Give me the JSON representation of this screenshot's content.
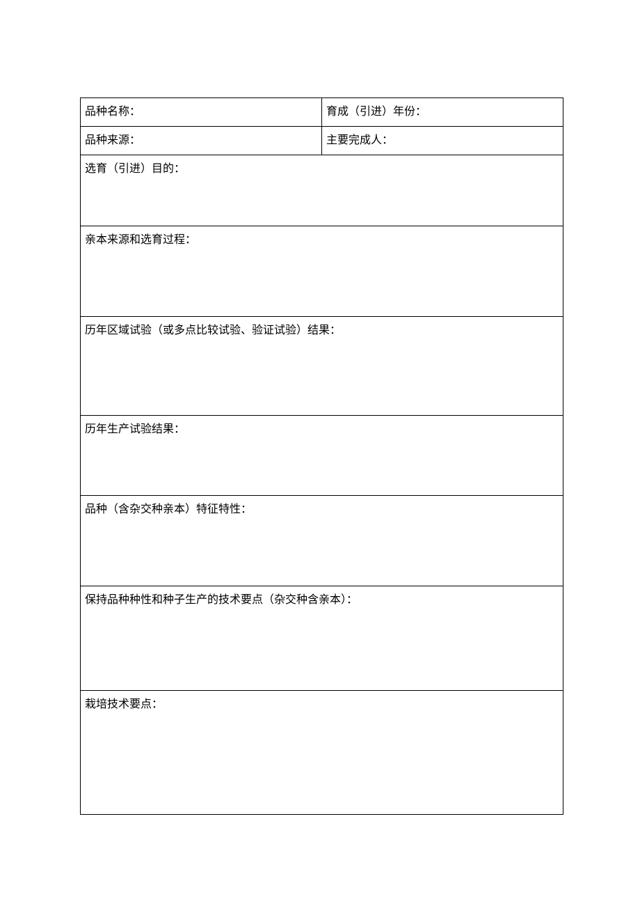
{
  "fields": {
    "varietyName": "品种名称：",
    "developedYear": "育成（引进）年份：",
    "varietySource": "品种来源：",
    "mainCompleter": "主要完成人：",
    "breedingPurpose": "选育（引进）目的：",
    "parentSource": "亲本来源和选育过程：",
    "regionalTrial": "历年区域试验（或多点比较试验、验证试验）结果：",
    "productionTrial": "历年生产试验结果：",
    "varietyChar": "品种（含杂交种亲本）特征特性：",
    "seedProduction": "保持品种种性和种子生产的技术要点（杂交种含亲本）：",
    "cultivation": "栽培技术要点："
  }
}
